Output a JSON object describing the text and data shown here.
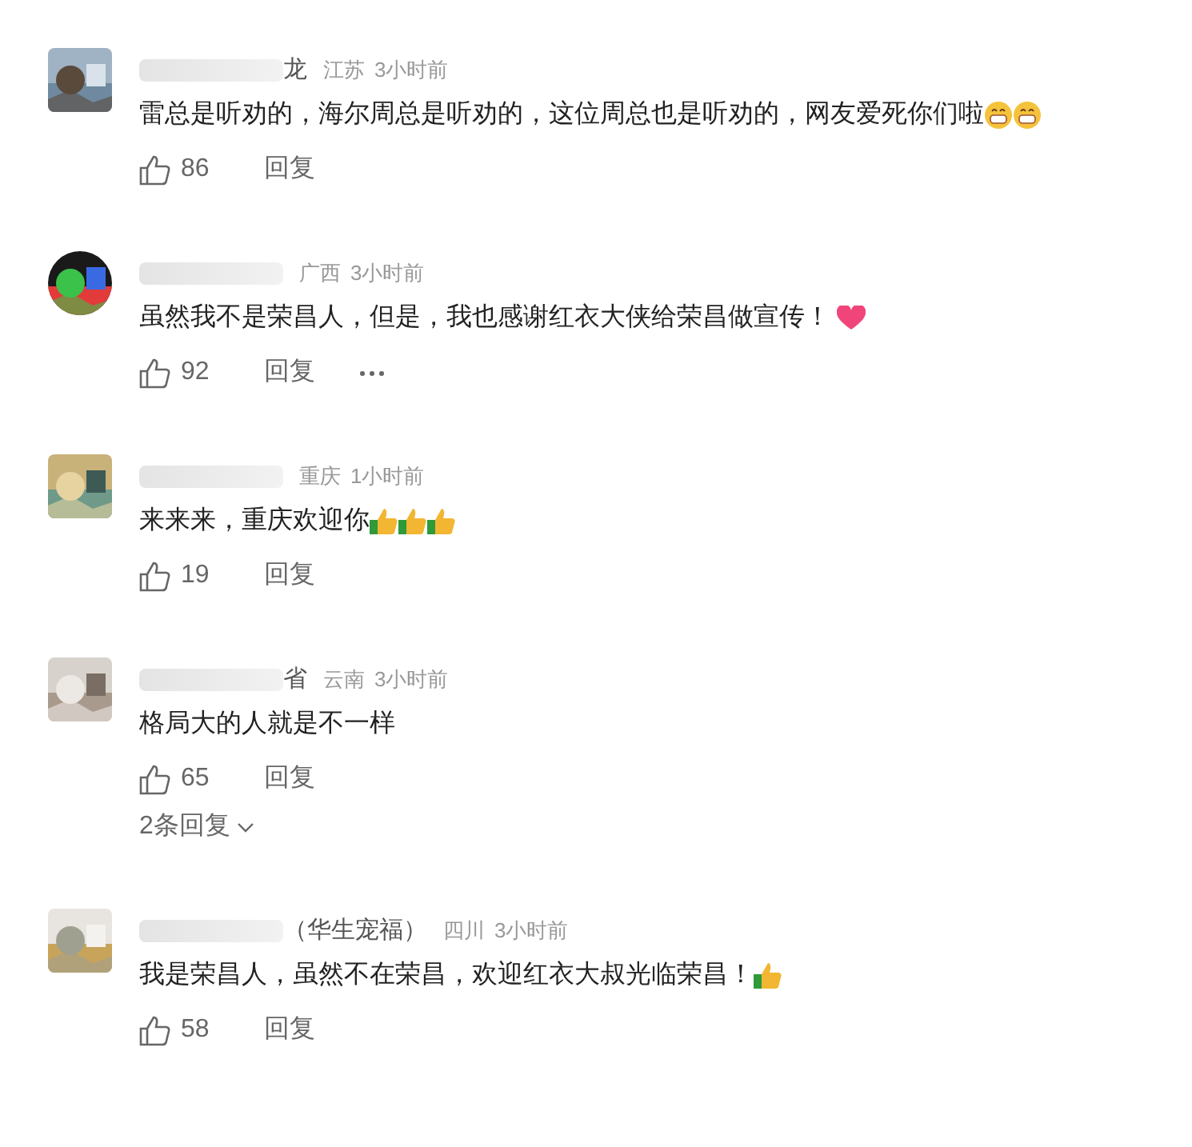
{
  "comments": [
    {
      "name_visible": "龙",
      "region": "江苏",
      "time": "3小时前",
      "text": "雷总是听劝的，海尔周总是听劝的，这位周总也是听劝的，网友爱死你们啦",
      "emojis": [
        {
          "kind": "grin"
        },
        {
          "kind": "grin"
        }
      ],
      "likes": "86",
      "reply_label": "回复",
      "more_menu": false
    },
    {
      "region": "广西",
      "time": "3小时前",
      "text": "虽然我不是荣昌人，但是，我也感谢红衣大侠给荣昌做宣传！",
      "emojis": [
        {
          "kind": "heart"
        }
      ],
      "likes": "92",
      "reply_label": "回复",
      "more_menu": true
    },
    {
      "region": "重庆",
      "time": "1小时前",
      "text": "来来来，重庆欢迎你",
      "emojis": [
        {
          "kind": "thumbs"
        },
        {
          "kind": "thumbs"
        },
        {
          "kind": "thumbs"
        }
      ],
      "likes": "19",
      "reply_label": "回复",
      "more_menu": false
    },
    {
      "name_visible": "省",
      "region": "云南",
      "time": "3小时前",
      "text": "格局大的人就是不一样",
      "likes": "65",
      "reply_label": "回复",
      "more_menu": false,
      "replies": "2条回复"
    },
    {
      "name_visible": "（华生宠福）",
      "region": "四川",
      "time": "3小时前",
      "text": "我是荣昌人，虽然不在荣昌，欢迎红衣大叔光临荣昌！",
      "emojis": [
        {
          "kind": "thumbs"
        }
      ],
      "likes": "58",
      "reply_label": "回复",
      "more_menu": false
    }
  ]
}
